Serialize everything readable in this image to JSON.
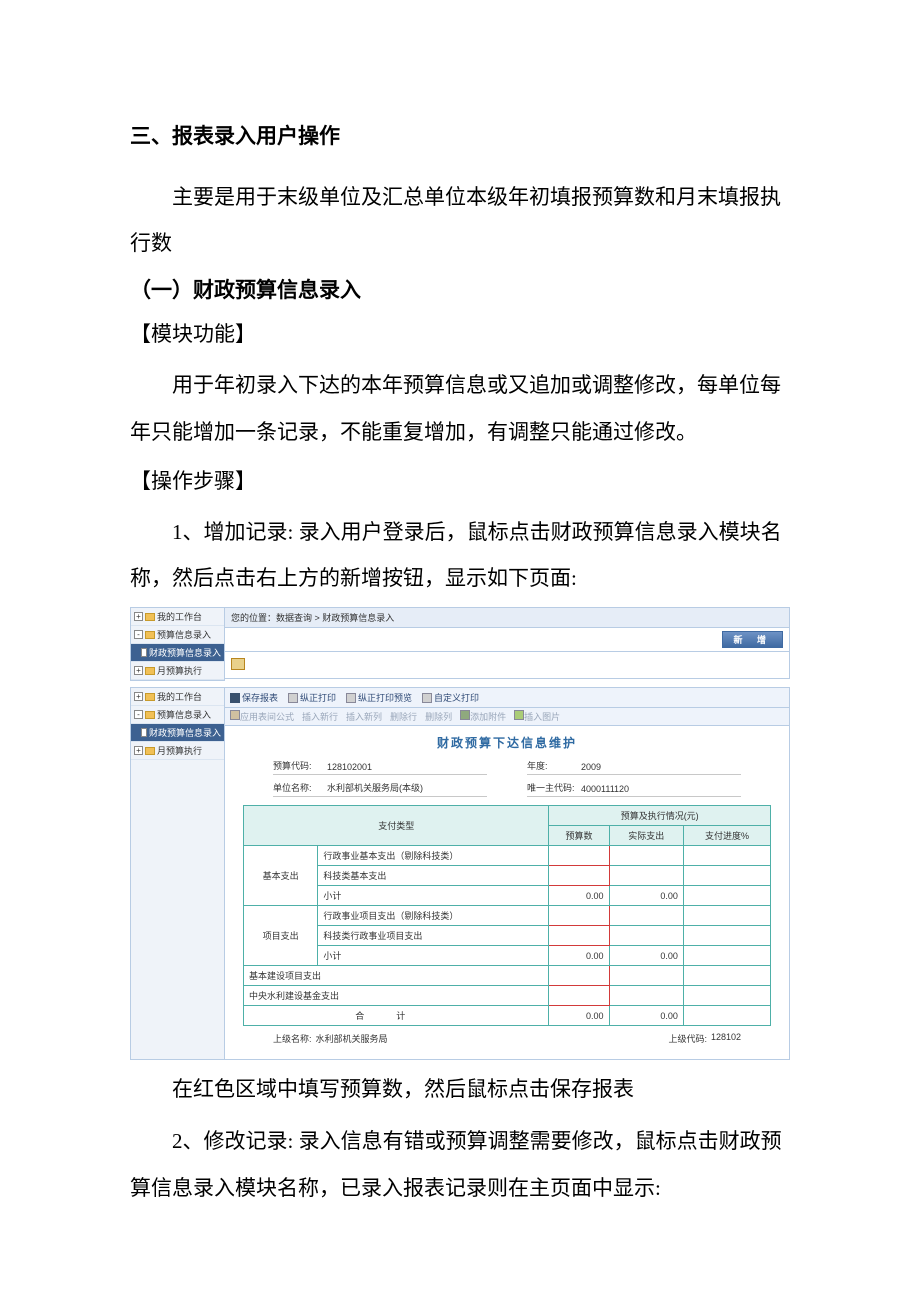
{
  "heading": "三、报表录入用户操作",
  "intro": "主要是用于末级单位及汇总单位本级年初填报预算数和月末填报执行数",
  "sub1": "（一）财政预算信息录入",
  "bracket1": "【模块功能】",
  "para1": "用于年初录入下达的本年预算信息或又追加或调整修改，每单位每年只能增加一条记录，不能重复增加，有调整只能通过修改。",
  "bracket2": "【操作步骤】",
  "para2": "1、增加记录: 录入用户登录后，鼠标点击财政预算信息录入模块名称，然后点击右上方的新增按钮，显示如下页面:",
  "line_fill": "在红色区域中填写预算数，然后鼠标点击保存报表",
  "para3": "2、修改记录: 录入信息有错或预算调整需要修改，鼠标点击财政预算信息录入模块名称，已录入报表记录则在主页面中显示:",
  "nav": {
    "n1": "我的工作台",
    "n2": "预算信息录入",
    "n3": "财政预算信息录入",
    "n4": "月预算执行"
  },
  "shot1": {
    "crumb": "您的位置：数据查询 > 财政预算信息录入",
    "btn_new": "新 增"
  },
  "toolbar": {
    "save": "保存报表",
    "print1": "纵正打印",
    "preview": "纵正打印预览",
    "custom": "自定义打印",
    "sigma": "应用表间公式",
    "insrow": "插入新行",
    "inscol": "插入新列",
    "delrow": "删除行",
    "delcol": "删除列",
    "attach": "添加附件",
    "img": "插入图片"
  },
  "form": {
    "title": "财政预算下达信息维护",
    "f1_lbl": "预算代码:",
    "f1_val": "128102001",
    "f2_lbl": "年度:",
    "f2_val": "2009",
    "f3_lbl": "单位名称:",
    "f3_val": "水利部机关服务局(本级)",
    "f4_lbl": "唯一主代码:",
    "f4_val": "4000111120",
    "foot_l_lbl": "上级名称:",
    "foot_l_val": "水利部机关服务局",
    "foot_r_lbl": "上级代码:",
    "foot_r_val": "128102"
  },
  "chart_data": {
    "type": "table",
    "head_type": "支付类型",
    "head_group": "预算及执行情况(元)",
    "head_c1": "预算数",
    "head_c2": "实际支出",
    "head_c3": "支付进度%",
    "groups": [
      {
        "name": "基本支出",
        "rows": [
          {
            "label": "行政事业基本支出（剔除科技类）",
            "budget_red": true,
            "actual": "",
            "pct": ""
          },
          {
            "label": "科技类基本支出",
            "budget_red": true,
            "actual": "",
            "pct": ""
          },
          {
            "label": "小计",
            "budget": "0.00",
            "actual": "0.00",
            "pct": ""
          }
        ]
      },
      {
        "name": "项目支出",
        "rows": [
          {
            "label": "行政事业项目支出（剔除科技类）",
            "budget_red": true,
            "actual": "",
            "pct": ""
          },
          {
            "label": "科技类行政事业项目支出",
            "budget_red": true,
            "actual": "",
            "pct": ""
          },
          {
            "label": "小计",
            "budget": "0.00",
            "actual": "0.00",
            "pct": ""
          }
        ]
      }
    ],
    "single_rows": [
      {
        "label": "基本建设项目支出",
        "budget_red": true
      },
      {
        "label": "中央水利建设基金支出",
        "budget_red": true
      }
    ],
    "total_label": "合计",
    "total_budget": "0.00",
    "total_actual": "0.00"
  }
}
